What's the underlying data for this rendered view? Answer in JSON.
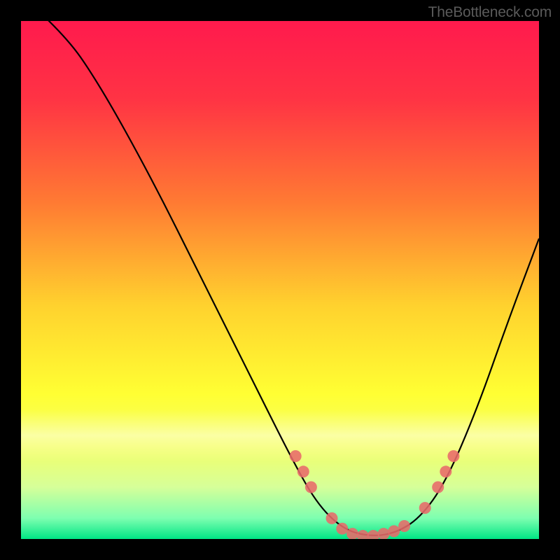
{
  "watermark": "TheBottleneck.com",
  "chart_data": {
    "type": "line",
    "title": "",
    "xlabel": "",
    "ylabel": "",
    "xlim": [
      0,
      100
    ],
    "ylim": [
      0,
      100
    ],
    "curve": [
      {
        "x": 0,
        "y": 105
      },
      {
        "x": 8,
        "y": 98
      },
      {
        "x": 15,
        "y": 88
      },
      {
        "x": 25,
        "y": 70
      },
      {
        "x": 35,
        "y": 50
      },
      {
        "x": 45,
        "y": 30
      },
      {
        "x": 52,
        "y": 16
      },
      {
        "x": 57,
        "y": 7
      },
      {
        "x": 62,
        "y": 2
      },
      {
        "x": 67,
        "y": 0.5
      },
      {
        "x": 72,
        "y": 1
      },
      {
        "x": 77,
        "y": 4
      },
      {
        "x": 82,
        "y": 11
      },
      {
        "x": 88,
        "y": 25
      },
      {
        "x": 94,
        "y": 42
      },
      {
        "x": 100,
        "y": 58
      }
    ],
    "markers": [
      {
        "x": 53,
        "y": 16
      },
      {
        "x": 54.5,
        "y": 13
      },
      {
        "x": 56,
        "y": 10
      },
      {
        "x": 60,
        "y": 4
      },
      {
        "x": 62,
        "y": 2
      },
      {
        "x": 64,
        "y": 1
      },
      {
        "x": 66,
        "y": 0.6
      },
      {
        "x": 68,
        "y": 0.6
      },
      {
        "x": 70,
        "y": 1
      },
      {
        "x": 72,
        "y": 1.5
      },
      {
        "x": 74,
        "y": 2.5
      },
      {
        "x": 78,
        "y": 6
      },
      {
        "x": 80.5,
        "y": 10
      },
      {
        "x": 82,
        "y": 13
      },
      {
        "x": 83.5,
        "y": 16
      }
    ],
    "gradient_stops": [
      {
        "offset": 0.0,
        "color": "#ff1a4d"
      },
      {
        "offset": 0.15,
        "color": "#ff3344"
      },
      {
        "offset": 0.35,
        "color": "#ff7a33"
      },
      {
        "offset": 0.55,
        "color": "#ffd22e"
      },
      {
        "offset": 0.72,
        "color": "#ffff33"
      },
      {
        "offset": 0.82,
        "color": "#f4ff66"
      },
      {
        "offset": 0.9,
        "color": "#d6ff99"
      },
      {
        "offset": 0.96,
        "color": "#7dffb0"
      },
      {
        "offset": 1.0,
        "color": "#00e585"
      }
    ],
    "bright_band": {
      "y0": 0.75,
      "y1": 0.85
    }
  }
}
